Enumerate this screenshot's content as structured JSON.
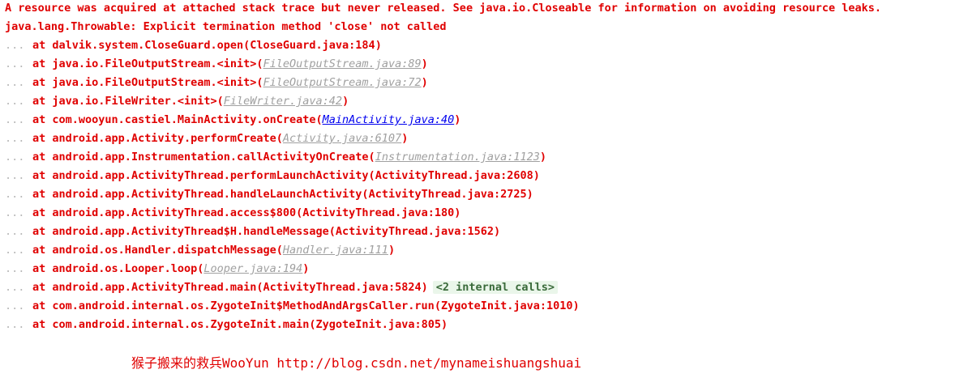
{
  "console": {
    "header": "A resource was acquired at attached stack trace but never released. See java.io.Closeable for information on avoiding resource leaks.",
    "exception": "java.lang.Throwable: Explicit termination method 'close' not called",
    "fold_marker": "...",
    "at_keyword": "at",
    "frames": [
      {
        "method": "dalvik.system.CloseGuard.open",
        "open": "(",
        "location": "CloseGuard.java:184",
        "close": ")",
        "link": "none"
      },
      {
        "method": "java.io.FileOutputStream.<init>",
        "open": "(",
        "location": "FileOutputStream.java:89",
        "close": ")",
        "link": "gray"
      },
      {
        "method": "java.io.FileOutputStream.<init>",
        "open": "(",
        "location": "FileOutputStream.java:72",
        "close": ")",
        "link": "gray"
      },
      {
        "method": "java.io.FileWriter.<init>",
        "open": "(",
        "location": "FileWriter.java:42",
        "close": ")",
        "link": "gray"
      },
      {
        "method": "com.wooyun.castiel.MainActivity.onCreate",
        "open": "(",
        "location": "MainActivity.java:40",
        "close": ")",
        "link": "blue"
      },
      {
        "method": "android.app.Activity.performCreate",
        "open": "(",
        "location": "Activity.java:6107",
        "close": ")",
        "link": "gray"
      },
      {
        "method": "android.app.Instrumentation.callActivityOnCreate",
        "open": "(",
        "location": "Instrumentation.java:1123",
        "close": ")",
        "link": "gray"
      },
      {
        "method": "android.app.ActivityThread.performLaunchActivity",
        "open": "(",
        "location": "ActivityThread.java:2608",
        "close": ")",
        "link": "none"
      },
      {
        "method": "android.app.ActivityThread.handleLaunchActivity",
        "open": "(",
        "location": "ActivityThread.java:2725",
        "close": ")",
        "link": "none"
      },
      {
        "method": "android.app.ActivityThread.access$800",
        "open": "(",
        "location": "ActivityThread.java:180",
        "close": ")",
        "link": "none"
      },
      {
        "method": "android.app.ActivityThread$H.handleMessage",
        "open": "(",
        "location": "ActivityThread.java:1562",
        "close": ")",
        "link": "none"
      },
      {
        "method": "android.os.Handler.dispatchMessage",
        "open": "(",
        "location": "Handler.java:111",
        "close": ")",
        "link": "gray"
      },
      {
        "method": "android.os.Looper.loop",
        "open": "(",
        "location": "Looper.java:194",
        "close": ")",
        "link": "gray"
      },
      {
        "method": "android.app.ActivityThread.main",
        "open": "(",
        "location": "ActivityThread.java:5824",
        "close": ")",
        "link": "none",
        "extra": "<2 internal calls>"
      },
      {
        "method": "com.android.internal.os.ZygoteInit$MethodAndArgsCaller.run",
        "open": "(",
        "location": "ZygoteInit.java:1010",
        "close": ")",
        "link": "none"
      },
      {
        "method": "com.android.internal.os.ZygoteInit.main",
        "open": "(",
        "location": "ZygoteInit.java:805",
        "close": ")",
        "link": "none"
      }
    ]
  },
  "watermark": "猴子搬来的救兵WooYun http://blog.csdn.net/mynameishuangshuai",
  "colors": {
    "error_text": "#e00000",
    "link_gray": "#a0a0a0",
    "link_blue": "#0000ee",
    "internal_calls_bg": "#eaf6ea",
    "fold_dots": "#b8b8b8"
  }
}
